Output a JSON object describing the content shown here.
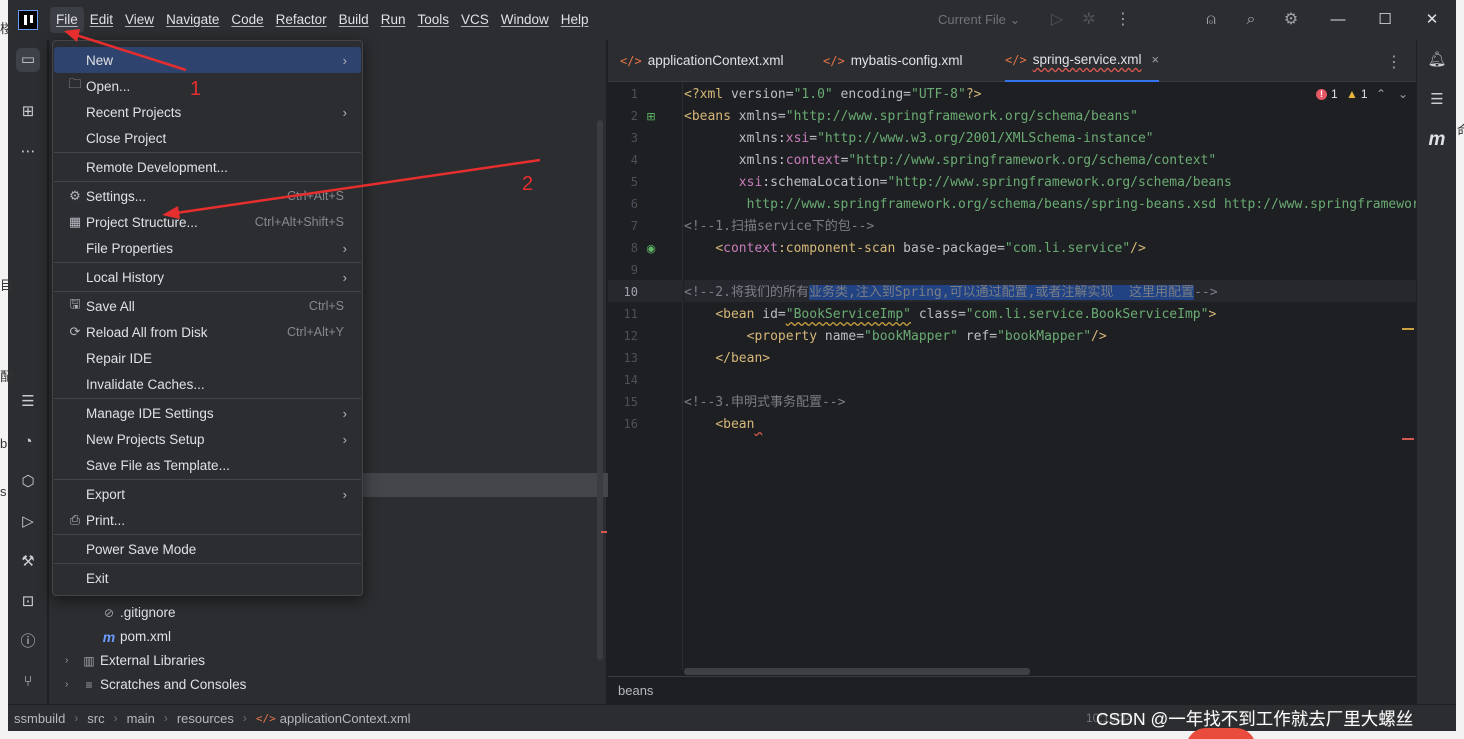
{
  "menubar": [
    "File",
    "Edit",
    "View",
    "Navigate",
    "Code",
    "Refactor",
    "Build",
    "Run",
    "Tools",
    "VCS",
    "Window",
    "Help"
  ],
  "run_config": "Current File",
  "file_menu": [
    {
      "label": "New",
      "shortcut": "",
      "arrow": true,
      "icon": "",
      "sep_before": false
    },
    {
      "label": "Open...",
      "shortcut": "",
      "arrow": false,
      "icon": "folder-icon",
      "sep_before": false
    },
    {
      "label": "Recent Projects",
      "shortcut": "",
      "arrow": true,
      "icon": "",
      "sep_before": false
    },
    {
      "label": "Close Project",
      "shortcut": "",
      "arrow": false,
      "icon": "",
      "sep_before": false
    },
    {
      "label": "Remote Development...",
      "shortcut": "",
      "arrow": false,
      "icon": "",
      "sep_before": true
    },
    {
      "label": "Settings...",
      "shortcut": "Ctrl+Alt+S",
      "arrow": false,
      "icon": "gear-icon",
      "sep_before": true
    },
    {
      "label": "Project Structure...",
      "shortcut": "Ctrl+Alt+Shift+S",
      "arrow": false,
      "icon": "project-structure-icon",
      "sep_before": false
    },
    {
      "label": "File Properties",
      "shortcut": "",
      "arrow": true,
      "icon": "",
      "sep_before": false
    },
    {
      "label": "Local History",
      "shortcut": "",
      "arrow": true,
      "icon": "",
      "sep_before": true
    },
    {
      "label": "Save All",
      "shortcut": "Ctrl+S",
      "arrow": false,
      "icon": "save-icon",
      "sep_before": true
    },
    {
      "label": "Reload All from Disk",
      "shortcut": "Ctrl+Alt+Y",
      "arrow": false,
      "icon": "reload-icon",
      "sep_before": false
    },
    {
      "label": "Repair IDE",
      "shortcut": "",
      "arrow": false,
      "icon": "",
      "sep_before": false
    },
    {
      "label": "Invalidate Caches...",
      "shortcut": "",
      "arrow": false,
      "icon": "",
      "sep_before": false
    },
    {
      "label": "Manage IDE Settings",
      "shortcut": "",
      "arrow": true,
      "icon": "",
      "sep_before": true
    },
    {
      "label": "New Projects Setup",
      "shortcut": "",
      "arrow": true,
      "icon": "",
      "sep_before": false
    },
    {
      "label": "Save File as Template...",
      "shortcut": "",
      "arrow": false,
      "icon": "",
      "sep_before": false
    },
    {
      "label": "Export",
      "shortcut": "",
      "arrow": true,
      "icon": "",
      "sep_before": true
    },
    {
      "label": "Print...",
      "shortcut": "",
      "arrow": false,
      "icon": "print-icon",
      "sep_before": false
    },
    {
      "label": "Power Save Mode",
      "shortcut": "",
      "arrow": false,
      "icon": "",
      "sep_before": true
    },
    {
      "label": "Exit",
      "shortcut": "",
      "arrow": false,
      "icon": "",
      "sep_before": true
    }
  ],
  "project_tree": [
    {
      "label": ".gitignore",
      "icon": "gitignore-icon",
      "indent": 2,
      "chevron": false
    },
    {
      "label": "pom.xml",
      "icon": "maven-icon",
      "indent": 2,
      "chevron": false
    },
    {
      "label": "External Libraries",
      "icon": "library-icon",
      "indent": 0,
      "chevron": true
    },
    {
      "label": "Scratches and Consoles",
      "icon": "scratches-icon",
      "indent": 0,
      "chevron": true
    }
  ],
  "tabs": [
    {
      "label": "applicationContext.xml",
      "active": false
    },
    {
      "label": "mybatis-config.xml",
      "active": false
    },
    {
      "label": "spring-service.xml",
      "active": true
    }
  ],
  "inspections": {
    "errors": "1",
    "warnings": "1"
  },
  "code_lines": [
    [
      [
        "t-tag",
        "<?xml "
      ],
      [
        "t-attr",
        "version="
      ],
      [
        "t-str",
        "\"1.0\""
      ],
      [
        "t-attr",
        " encoding="
      ],
      [
        "t-str",
        "\"UTF-8\""
      ],
      [
        "t-tag",
        "?>"
      ]
    ],
    [
      [
        "t-tag",
        "<beans "
      ],
      [
        "t-attr",
        "xmlns="
      ],
      [
        "t-str",
        "\"http://www.springframework.org/schema/beans\""
      ]
    ],
    [
      [
        "",
        "       "
      ],
      [
        "t-attr",
        "xmlns:"
      ],
      [
        "t-ns",
        "xsi"
      ],
      [
        "t-attr",
        "="
      ],
      [
        "t-str",
        "\"http://www.w3.org/2001/XMLSchema-instance\""
      ]
    ],
    [
      [
        "",
        "       "
      ],
      [
        "t-attr",
        "xmlns:"
      ],
      [
        "t-ns",
        "context"
      ],
      [
        "t-attr",
        "="
      ],
      [
        "t-str",
        "\"http://www.springframework.org/schema/context\""
      ]
    ],
    [
      [
        "",
        "       "
      ],
      [
        "t-ns",
        "xsi"
      ],
      [
        "t-attr",
        ":schemaLocation="
      ],
      [
        "t-str",
        "\"http://www.springframework.org/schema/beans"
      ]
    ],
    [
      [
        "",
        "        "
      ],
      [
        "t-str",
        "http://www.springframework.org/schema/beans/spring-beans.xsd http://www.springframework.org/schema/context"
      ]
    ],
    [
      [
        "t-cmt",
        "<!--1.扫描service下的包-->"
      ]
    ],
    [
      [
        "",
        "    "
      ],
      [
        "t-tag",
        "<"
      ],
      [
        "t-ns",
        "context"
      ],
      [
        "t-tag",
        ":component-scan "
      ],
      [
        "t-attr",
        "base-package="
      ],
      [
        "t-str",
        "\"com.li.service\""
      ],
      [
        "t-tag",
        "/>"
      ]
    ],
    [],
    [
      [
        "t-cmt",
        "<!--2.将我们的所有"
      ],
      [
        "t-cmt t-sel",
        "业务类,注入到Spring,可以通过配置,或者注解实现  这里用配置"
      ],
      [
        "t-cmt",
        "-->"
      ]
    ],
    [
      [
        "",
        "    "
      ],
      [
        "t-tag",
        "<bean "
      ],
      [
        "t-attr",
        "id="
      ],
      [
        "t-str t-wavy",
        "\"BookServiceImp\""
      ],
      [
        "t-attr",
        " class="
      ],
      [
        "t-str",
        "\"com.li.service.BookServiceImp\""
      ],
      [
        "t-tag",
        ">"
      ]
    ],
    [
      [
        "",
        "        "
      ],
      [
        "t-tag",
        "<property "
      ],
      [
        "t-attr",
        "name="
      ],
      [
        "t-str",
        "\"bookMapper\""
      ],
      [
        "t-attr",
        " ref="
      ],
      [
        "t-str",
        "\"bookMapper\""
      ],
      [
        "t-tag",
        "/>"
      ]
    ],
    [
      [
        "",
        "    "
      ],
      [
        "t-tag",
        "</bean>"
      ]
    ],
    [],
    [
      [
        "t-cmt",
        "<!--3.申明式事务配置-->"
      ]
    ],
    [
      [
        "",
        "    "
      ],
      [
        "t-tag",
        "<bean"
      ],
      [
        "t-err",
        " "
      ]
    ]
  ],
  "editor_breadcrumb": "beans",
  "status_breadcrumb": [
    "ssmbuild",
    "src",
    "main",
    "resources",
    "applicationContext.xml"
  ],
  "status_right": "10:10/34",
  "watermark": "CSDN @一年找不到工作就去厂里大螺丝",
  "annotations": [
    "1",
    "2"
  ],
  "edge_chars": [
    "楼",
    "目",
    "配",
    "b",
    "s",
    "命"
  ],
  "colors": {
    "accent": "#3574f0",
    "error": "#e55765",
    "warning": "#e6b73e",
    "annotation": "#e62e2e"
  }
}
